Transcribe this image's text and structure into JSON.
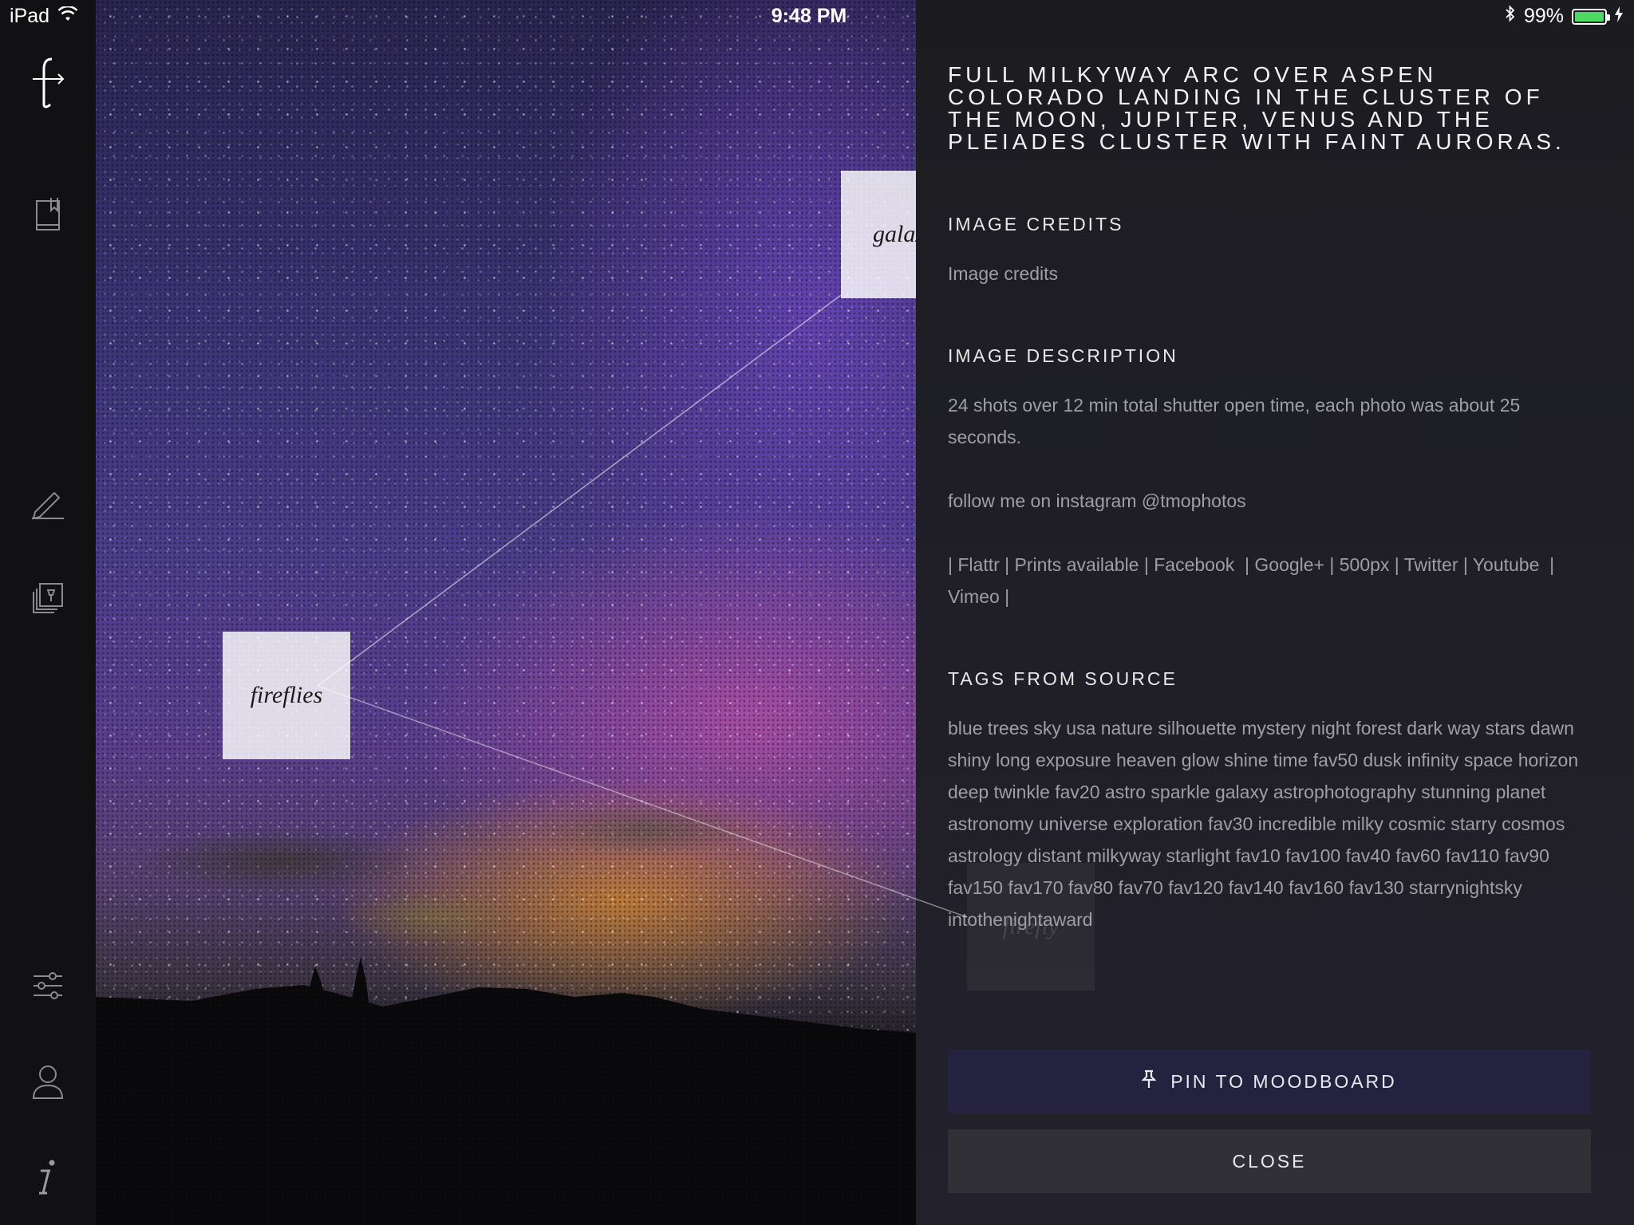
{
  "status_bar": {
    "device": "iPad",
    "time": "9:48 PM",
    "battery": "99%",
    "battery_level": 0.99,
    "battery_color": "#4cd964"
  },
  "sidebar": {
    "items": [
      {
        "name": "logo",
        "icon": "logo-mark-icon"
      },
      {
        "name": "library",
        "icon": "book-icon"
      },
      {
        "name": "edit",
        "icon": "pencil-icon"
      },
      {
        "name": "moodboards",
        "icon": "pinned-stack-icon"
      },
      {
        "name": "settings",
        "icon": "sliders-icon"
      },
      {
        "name": "profile",
        "icon": "user-icon"
      },
      {
        "name": "info",
        "icon": "info-icon"
      }
    ]
  },
  "photo": {
    "tags": [
      "galaxy",
      "fireflies",
      "firefly"
    ]
  },
  "panel": {
    "headline": "FULL MILKYWAY ARC OVER ASPEN COLORADO LANDING IN THE CLUSTER OF THE MOON, JUPITER, VENUS AND THE   PLEIADES CLUSTER WITH FAINT AURORAS.",
    "credits_title": "IMAGE CREDITS",
    "credits_text": "Image credits",
    "description_title": "IMAGE DESCRIPTION",
    "description_paragraphs": [
      "24 shots over 12 min total shutter open time, each photo was about 25 seconds.",
      "follow me on instagram @tmophotos",
      "| Flattr | Prints available | Facebook  | Google+ | 500px | Twitter | Youtube  | Vimeo |"
    ],
    "tags_title": "TAGS FROM SOURCE",
    "tags_text": "blue trees sky usa nature silhouette mystery night forest dark way stars dawn shiny long exposure heaven glow shine time fav50 dusk infinity space horizon deep twinkle fav20 astro sparkle galaxy astrophotography stunning planet astronomy universe exploration fav30 incredible milky cosmic starry cosmos astrology distant milkyway starlight fav10 fav100 fav40 fav60 fav110 fav90 fav150 fav170 fav80 fav70 fav120 fav140 fav160 fav130 starrynightsky intothenightaward",
    "pin_button": "PIN TO MOODBOARD",
    "close_button": "CLOSE",
    "pin_button_color": "#25223f",
    "close_button_color": "#303036"
  }
}
